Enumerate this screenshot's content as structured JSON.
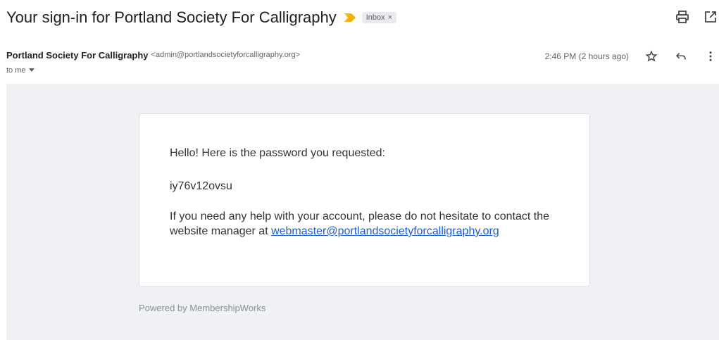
{
  "email": {
    "subject": "Your sign-in for Portland Society For Calligraphy",
    "label": "Inbox",
    "label_close": "×",
    "sender_name": "Portland Society For Calligraphy",
    "sender_email": "<admin@portlandsocietyforcalligraphy.org>",
    "time": "2:46 PM (2 hours ago)",
    "recipient": "to me"
  },
  "message": {
    "greeting": "Hello! Here is the password you requested:",
    "password": "iy76v12ovsu",
    "help_text": "If you need any help with your account, please do not hesitate to contact the website manager at ",
    "link_text": "webmaster@portlandsocietyforcalligraphy.org",
    "footer": "Powered by MembershipWorks"
  },
  "colors": {
    "importance": "#f4b400",
    "link": "#1a5fd1",
    "body_background": "#eff1f5"
  },
  "icons": [
    "importance-marker-icon",
    "print-icon",
    "open-in-new-window-icon",
    "star-icon",
    "reply-icon",
    "more-vert-icon",
    "dropdown-caret-icon"
  ]
}
